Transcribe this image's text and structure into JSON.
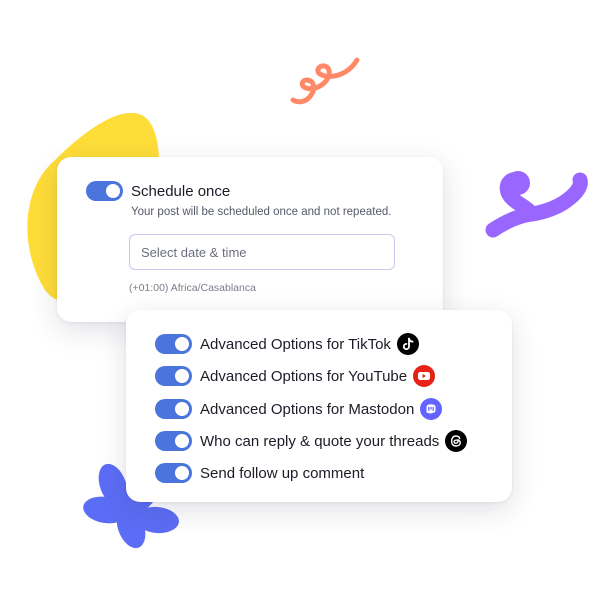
{
  "schedule": {
    "toggle_on": true,
    "title": "Schedule once",
    "description": "Your post will be scheduled once and not repeated.",
    "date_placeholder": "Select date & time",
    "timezone": "(+01:00) Africa/Casablanca"
  },
  "options": {
    "items": [
      {
        "label": "Advanced Options for TikTok",
        "icon": "tiktok-icon",
        "enabled": true
      },
      {
        "label": "Advanced Options for YouTube",
        "icon": "youtube-icon",
        "enabled": true
      },
      {
        "label": "Advanced Options for Mastodon",
        "icon": "mastodon-icon",
        "enabled": true
      },
      {
        "label": "Who can reply & quote your threads",
        "icon": "threads-icon",
        "enabled": true
      },
      {
        "label": "Send follow up comment",
        "icon": "",
        "enabled": true
      }
    ]
  },
  "colors": {
    "toggle": "#4b74dc",
    "yellow_blob": "#ffdd38",
    "purple_squiggle": "#9966ff",
    "orange_squiggle": "#ff8866",
    "blue_flower": "#5c6df5",
    "youtube": "#e62117",
    "mastodon": "#6364ff"
  }
}
